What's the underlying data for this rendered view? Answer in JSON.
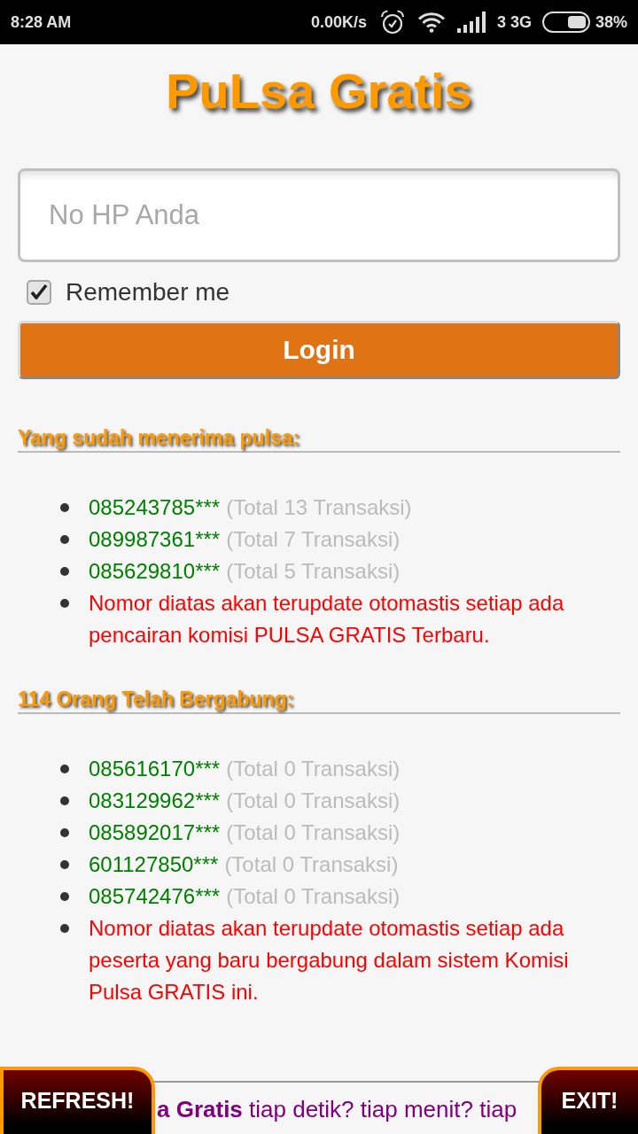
{
  "status_bar": {
    "time": "8:28 AM",
    "net_speed": "0.00K/s",
    "network": "3 3G",
    "battery": "38%"
  },
  "title": "PuLsa Gratis",
  "login_form": {
    "phone_field": {
      "placeholder": "No HP Anda"
    },
    "remember_me": {
      "label": "Remember me",
      "checked": true
    },
    "login_button": {
      "label": "Login"
    }
  },
  "sections": [
    {
      "heading": "Yang sudah menerima pulsa:",
      "items": [
        {
          "kind": "member",
          "number": "085243785***",
          "total": "(Total 13 Transaksi)"
        },
        {
          "kind": "member",
          "number": "089987361***",
          "total": "(Total 7 Transaksi)"
        },
        {
          "kind": "member",
          "number": "085629810***",
          "total": "(Total 5 Transaksi)"
        },
        {
          "kind": "note",
          "text": "Nomor diatas akan terupdate otomastis setiap ada pencairan komisi PULSA GRATIS Terbaru."
        }
      ]
    },
    {
      "heading": "114 Orang Telah Bergabung:",
      "items": [
        {
          "kind": "member",
          "number": "085616170***",
          "total": "(Total 0 Transaksi)"
        },
        {
          "kind": "member",
          "number": "083129962***",
          "total": "(Total 0 Transaksi)"
        },
        {
          "kind": "member",
          "number": "085892017***",
          "total": "(Total 0 Transaksi)"
        },
        {
          "kind": "member",
          "number": "601127850***",
          "total": "(Total 0 Transaksi)"
        },
        {
          "kind": "member",
          "number": "085742476***",
          "total": "(Total 0 Transaksi)"
        },
        {
          "kind": "note",
          "text": "Nomor diatas akan terupdate otomastis setiap ada peserta yang baru bergabung dalam sistem Komisi Pulsa GRATIS ini."
        }
      ]
    }
  ],
  "promo": {
    "text": "**a Gratis** tiap detik? tiap menit? tiap"
  },
  "floating_buttons": [
    {
      "label": "REFRESH!"
    },
    {
      "label": "EXIT!"
    }
  ]
}
